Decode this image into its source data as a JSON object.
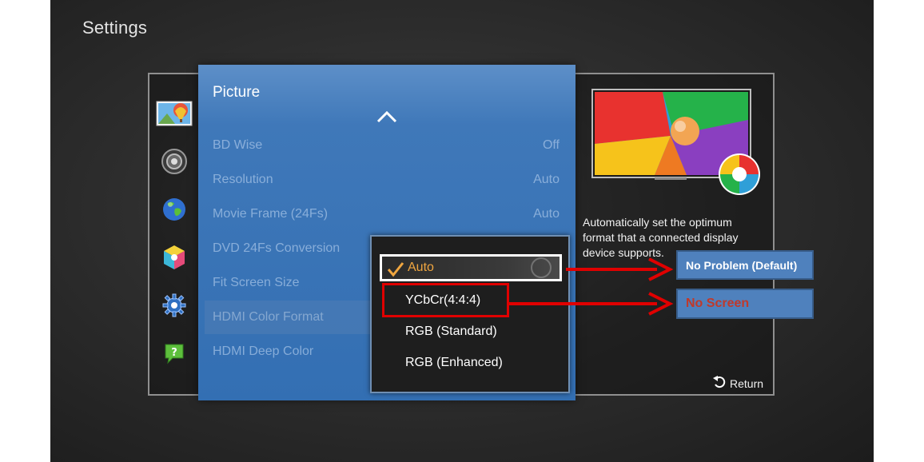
{
  "screen": {
    "title": "Settings"
  },
  "categories": [
    {
      "name": "picture-icon"
    },
    {
      "name": "sound-icon"
    },
    {
      "name": "broadcast-globe-icon"
    },
    {
      "name": "network-cube-icon"
    },
    {
      "name": "system-gear-icon"
    },
    {
      "name": "support-question-icon"
    }
  ],
  "panel": {
    "title": "Picture",
    "items": [
      {
        "label": "BD Wise",
        "value": "Off"
      },
      {
        "label": "Resolution",
        "value": "Auto"
      },
      {
        "label": "Movie Frame (24Fs)",
        "value": "Auto"
      },
      {
        "label": "DVD 24Fs Conversion",
        "value": ""
      },
      {
        "label": "Fit Screen Size",
        "value": ""
      },
      {
        "label": "HDMI Color Format",
        "value": ""
      },
      {
        "label": "HDMI Deep Color",
        "value": ""
      }
    ]
  },
  "dropdown": {
    "options": [
      {
        "label": "Auto",
        "selected": true
      },
      {
        "label": "YCbCr(4:4:4)",
        "selected": false
      },
      {
        "label": "RGB (Standard)",
        "selected": false
      },
      {
        "label": "RGB (Enhanced)",
        "selected": false
      }
    ]
  },
  "description": "Automatically set the optimum format that a connected display device supports.",
  "footer": {
    "return_label": "Return"
  },
  "annotations": {
    "callout_1": "No Problem (Default)",
    "callout_2": "No Screen"
  },
  "colors": {
    "panel_blue": "#3f78b9",
    "selected_text": "#f0a640",
    "annotation_red": "#e00000",
    "callout_blue": "#4f81bd"
  }
}
